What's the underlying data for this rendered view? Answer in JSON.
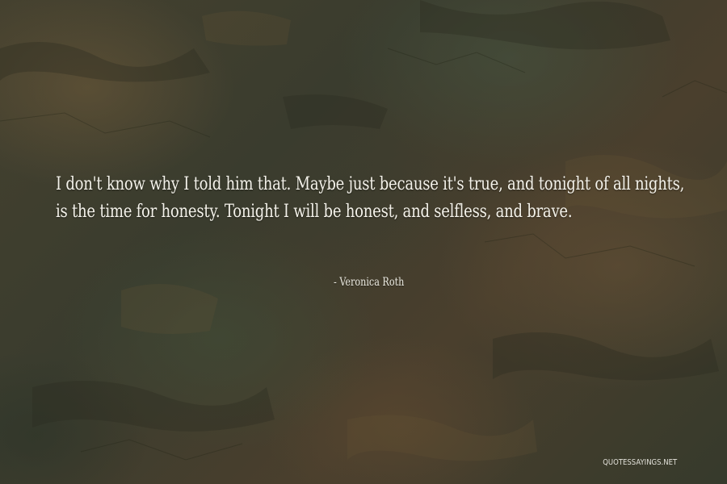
{
  "quote": {
    "text": "I don't know why I told him that. Maybe just because it's true, and tonight of all nights, is the time for honesty. Tonight I will be honest, and selfless, and brave.",
    "author_line": "- Veronica Roth"
  },
  "watermark": {
    "text": "QUOTESSAYINGS.NET"
  },
  "colors": {
    "text": "#f4f2ea",
    "background": "#3a3a2c"
  }
}
